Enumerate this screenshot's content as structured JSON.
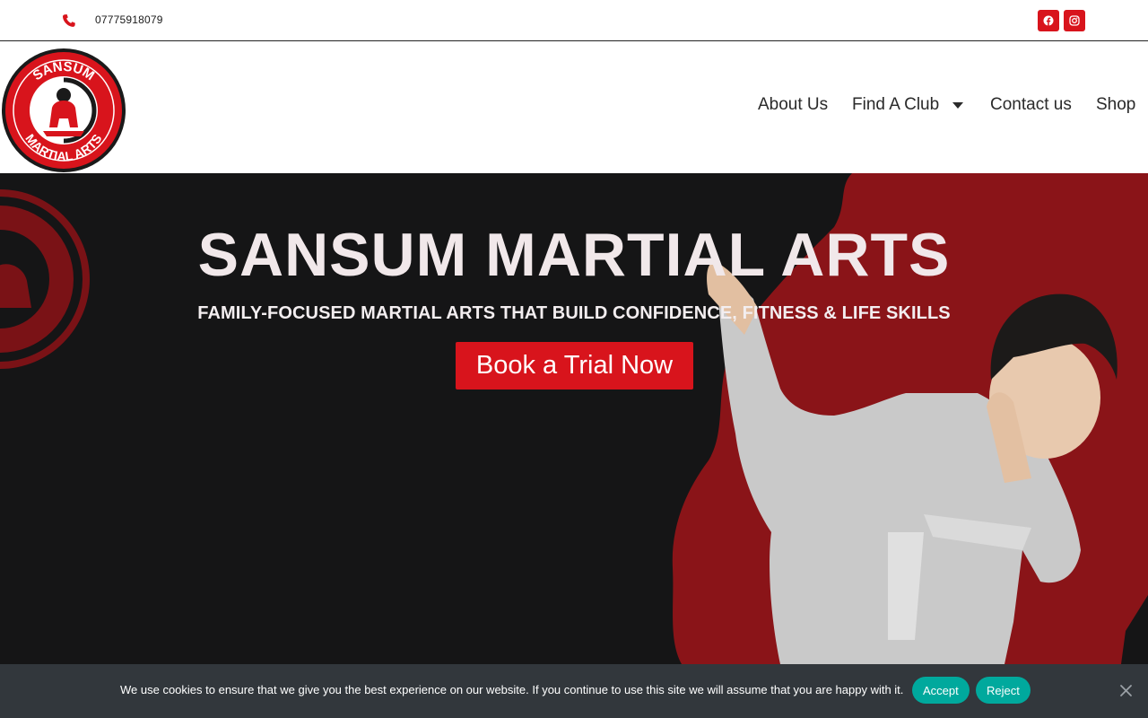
{
  "topbar": {
    "phone_icon": "phone-icon",
    "phone": "07775918079",
    "social": [
      {
        "name": "facebook",
        "icon": "facebook-icon"
      },
      {
        "name": "instagram",
        "icon": "instagram-icon"
      }
    ]
  },
  "header": {
    "logo": {
      "top_text": "SANSUM",
      "bottom_text": "MARTIAL ARTS"
    },
    "nav": {
      "about": "About Us",
      "club": "Find A Club",
      "contact": "Contact us",
      "shop": "Shop"
    }
  },
  "hero": {
    "title": "SANSUM MARTIAL ARTS",
    "subtitle": "FAMILY-FOCUSED MARTIAL ARTS THAT BUILD CONFIDENCE, FITNESS & LIFE SKILLS",
    "cta": "Book a Trial Now"
  },
  "cookie": {
    "text": "We use cookies to ensure that we give you the best experience on our website. If you continue to use this site we will assume that you are happy with it.",
    "accept": "Accept",
    "reject": "Reject",
    "close_icon": "close-icon"
  },
  "colors": {
    "brand_red": "#d8141c",
    "hero_dark": "#151516",
    "hero_red": "#8a1418",
    "cookie_bg": "#32373c",
    "cookie_btn": "#00a99d"
  }
}
